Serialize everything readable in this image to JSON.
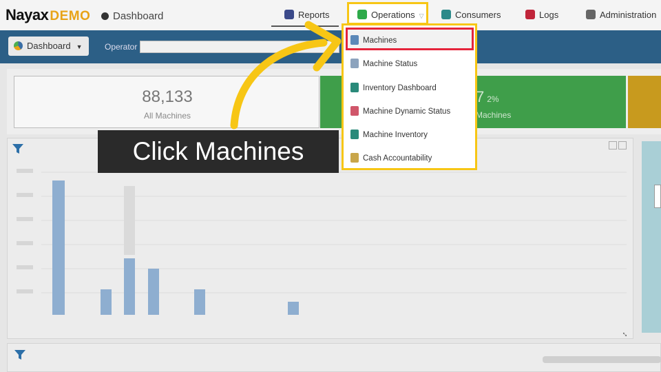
{
  "header": {
    "logo_text": "Nayax",
    "logo_suffix": "DEMO",
    "page_title": "Dashboard",
    "nav": [
      {
        "label": "Reports",
        "icon": "chart-icon",
        "color": "#3b4a8a"
      },
      {
        "label": "Operations",
        "icon": "operations-icon",
        "color": "#2eaa4a",
        "active": true
      },
      {
        "label": "Consumers",
        "icon": "consumers-icon",
        "color": "#2c8a8a"
      },
      {
        "label": "Logs",
        "icon": "logs-icon",
        "color": "#c0253a"
      },
      {
        "label": "Administration",
        "icon": "admin-icon",
        "color": "#666666"
      }
    ]
  },
  "subbar": {
    "dashboard_button": "Dashboard",
    "operator_label": "Operator",
    "operator_value": ""
  },
  "cards": {
    "all_machines_value": "88,133",
    "all_machines_label": "All Machines",
    "green_value": "7",
    "green_pct": "2%",
    "green_label": "Machines"
  },
  "dropdown": {
    "items": [
      {
        "label": "Machines",
        "icon": "machines-icon",
        "highlighted": true
      },
      {
        "label": "Machine Status",
        "icon": "machine-status-icon"
      },
      {
        "label": "Inventory Dashboard",
        "icon": "inventory-dashboard-icon"
      },
      {
        "label": "Machine Dynamic Status",
        "icon": "machine-dynamic-status-icon"
      },
      {
        "label": "Machine Inventory",
        "icon": "machine-inventory-icon"
      },
      {
        "label": "Cash Accountability",
        "icon": "cash-accountability-icon"
      }
    ]
  },
  "tooltip": {
    "text": "Click Machines"
  },
  "colors": {
    "highlight_yellow": "#f7c615",
    "highlight_red": "#e5243b",
    "brand_blue": "#2c5f86",
    "green_card": "#3f9e4a"
  }
}
